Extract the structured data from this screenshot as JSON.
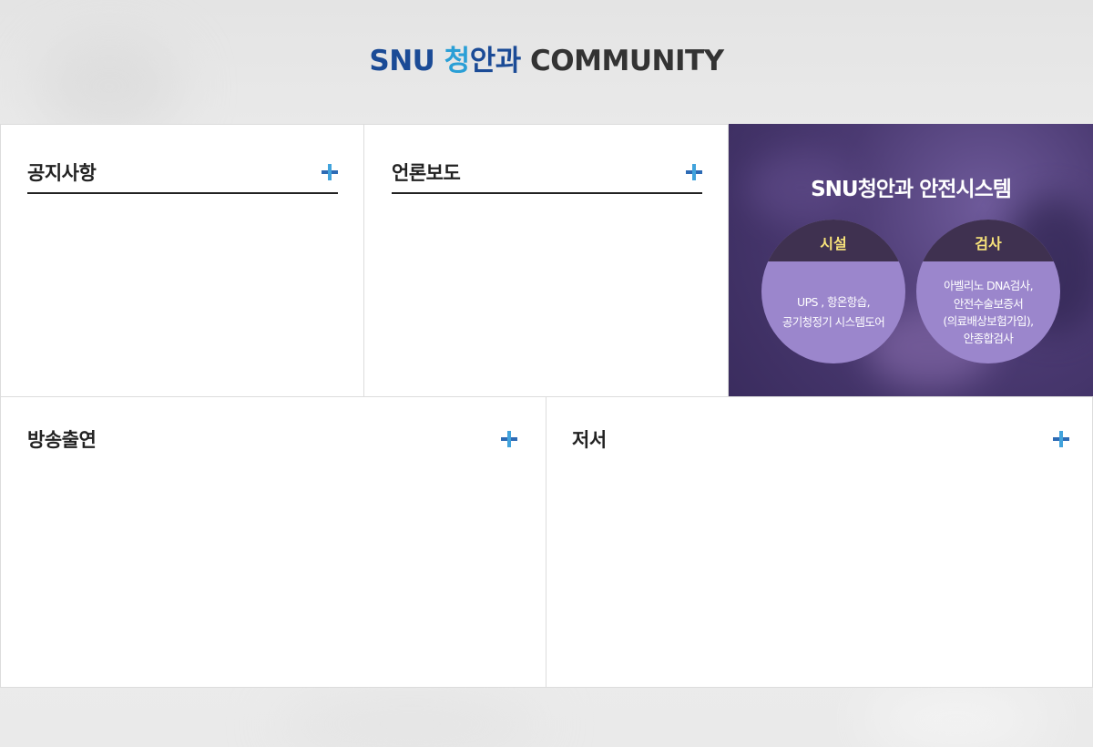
{
  "header": {
    "title_snu": "SNU",
    "title_cheong": "청",
    "title_angwa": "안과",
    "title_community": "COMMUNITY"
  },
  "boards": {
    "notice": {
      "title": "공지사항"
    },
    "press": {
      "title": "언론보도"
    },
    "broadcast": {
      "title": "방송출연"
    },
    "books": {
      "title": "저서"
    }
  },
  "promo": {
    "title": "SNU청안과 안전시스템",
    "facility": {
      "label": "시설",
      "lines": [
        "UPS , 항온항습,",
        "공기청정기 시스템도어"
      ]
    },
    "inspection": {
      "label": "검사",
      "lines": [
        "아벨리노 DNA검사,",
        "안전수술보증서",
        "(의료배상보험가입),",
        "안종합검사"
      ]
    }
  },
  "icons": {
    "more": "plus-icon"
  },
  "colors": {
    "brand_blue": "#1b4b96",
    "brand_sky": "#2a9fd6",
    "promo_purple": "#4b3a72",
    "promo_circle": "#9b86cc",
    "label_yellow": "#f7e27a"
  }
}
